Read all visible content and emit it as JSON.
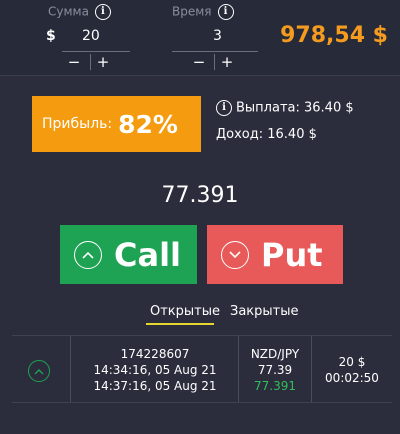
{
  "top": {
    "amount": {
      "label": "Сумма",
      "currency": "$",
      "value": "20",
      "minus": "−",
      "plus": "+"
    },
    "time": {
      "label": "Время",
      "value": "3",
      "minus": "−",
      "plus": "+"
    },
    "balance": "978,54 $",
    "info_glyph": "i"
  },
  "profit": {
    "label": "Прибыль:",
    "value": "82%"
  },
  "payout": {
    "text": "Выплата: 36.40 $"
  },
  "income": {
    "text": "Доход: 16.40 $"
  },
  "price": "77.391",
  "buttons": {
    "call": "Call",
    "put": "Put"
  },
  "tabs": {
    "open": "Открытые",
    "closed": "Закрытые",
    "active": "open"
  },
  "trades": [
    {
      "id": "174228607",
      "open_time": "14:34:16, 05 Aug 21",
      "close_time": "14:37:16, 05 Aug 21",
      "pair": "NZD/JPY",
      "open_price": "77.39",
      "current_price": "77.391",
      "amount": "20 $",
      "remaining": "00:02:50",
      "direction": "up"
    }
  ],
  "colors": {
    "background": "#2b2d3c",
    "accent_orange": "#f59b0f",
    "call_green": "#1ea253",
    "put_red": "#e85a5a",
    "tab_underline": "#e7d630",
    "price_up_green": "#2fbf5a"
  }
}
